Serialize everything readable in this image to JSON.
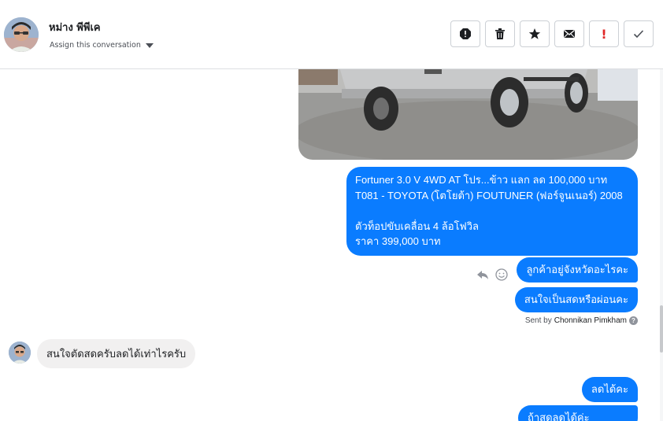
{
  "header": {
    "contact_name": "หม่าง พีพีเค",
    "assign_label": "Assign this conversation"
  },
  "actions": [
    {
      "name": "spam-icon"
    },
    {
      "name": "trash-icon"
    },
    {
      "name": "star-icon"
    },
    {
      "name": "mail-icon"
    },
    {
      "name": "important-icon",
      "label": "!"
    },
    {
      "name": "checkmark-icon"
    }
  ],
  "messages": {
    "listing": {
      "lines": [
        "Fortuner 3.0 V 4WD AT โปร...ข้าว แลก ลด 100,000 บาท",
        "T081 - TOYOTA (โตโยต้า) FOUTUNER (ฟอร์จูนเนอร์) 2008",
        "",
        " ตัวท็อปขับเคลื่อน 4 ล้อโฟวิล",
        "ราคา 399,000 บาท"
      ]
    },
    "out_1": "ลูกค้าอยู่จังหวัดอะไรคะ",
    "out_2": "สนใจเป็นสดหรือผ่อนคะ",
    "sent_by_prefix": "Sent by",
    "sent_by_name": "Chonnikan Pimkham",
    "in_1": "สนใจตัดสดครับลดได้เท่าไรครับ",
    "out_3": "ลดได้คะ",
    "out_4": "ถ้าสดลดได้ค่ะ"
  },
  "colors": {
    "accent": "#0a7cff",
    "incoming_bubble": "#f1f0f0",
    "important": "#e02828"
  }
}
